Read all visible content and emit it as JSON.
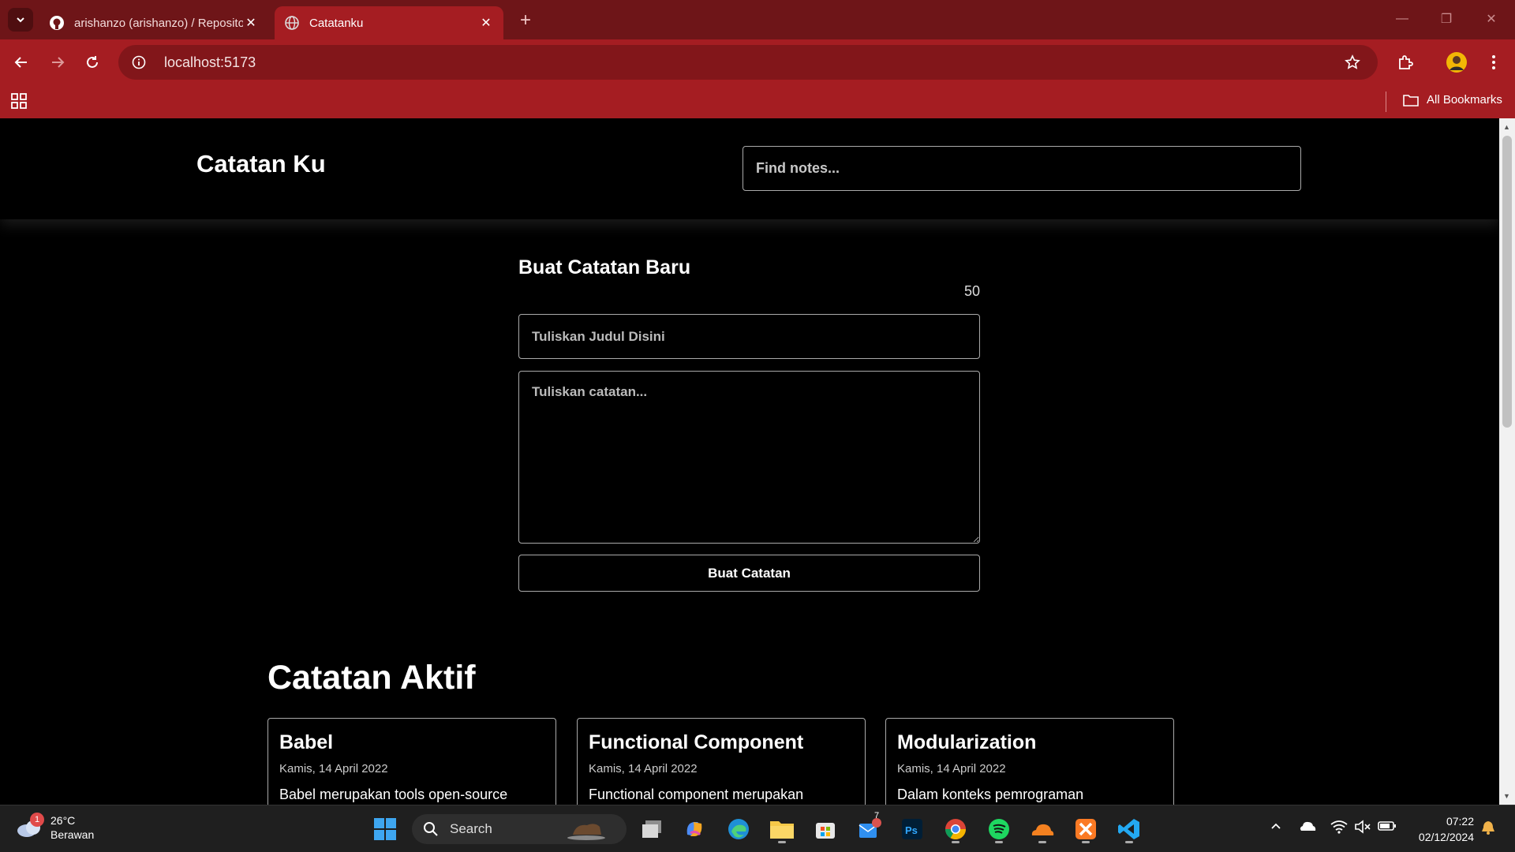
{
  "browser": {
    "tabs": [
      {
        "title": "arishanzo (arishanzo) / Reposito",
        "icon": "github-icon",
        "active": false
      },
      {
        "title": "Catatanku",
        "icon": "globe-icon",
        "active": true
      }
    ],
    "url": "localhost:5173",
    "bookmarks_label": "All Bookmarks"
  },
  "page": {
    "brand": "Catatan Ku",
    "search_placeholder": "Find notes...",
    "form": {
      "title": "Buat Catatan Baru",
      "char_remaining": "50",
      "title_placeholder": "Tuliskan Judul Disini",
      "body_placeholder": "Tuliskan catatan...",
      "submit_label": "Buat Catatan"
    },
    "active_section_title": "Catatan Aktif",
    "notes": [
      {
        "title": "Babel",
        "date": "Kamis, 14 April 2022",
        "body": "Babel merupakan tools open-source"
      },
      {
        "title": "Functional Component",
        "date": "Kamis, 14 April 2022",
        "body": "Functional component merupakan"
      },
      {
        "title": "Modularization",
        "date": "Kamis, 14 April 2022",
        "body": "Dalam konteks pemrograman"
      }
    ]
  },
  "taskbar": {
    "weather_temp": "26°C",
    "weather_desc": "Berawan",
    "weather_badge": "1",
    "search_label": "Search",
    "store_badge": "7",
    "time": "07:22",
    "date": "02/12/2024"
  },
  "colors": {
    "tabbar": "#6e1518",
    "toolbar": "#a51d22",
    "page_bg": "#000000",
    "accent_text": "#ffffff"
  }
}
